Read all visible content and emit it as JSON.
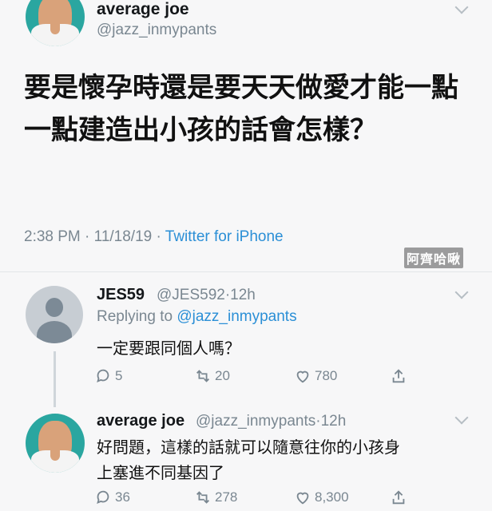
{
  "main_tweet": {
    "display_name": "average joe",
    "handle": "@jazz_inmypants",
    "text": "要是懷孕時還是要天天做愛才能一點一點建造出小孩的話會怎樣？",
    "time": "2:38 PM",
    "date": "11/18/19",
    "source": "Twitter for iPhone"
  },
  "watermark": "阿齊哈啾",
  "reply1": {
    "display_name": "JES59",
    "handle": "@JES592",
    "age": "12h",
    "replying_label": "Replying to",
    "replying_to": "@jazz_inmypants",
    "text": "一定要跟同個人嗎？",
    "replies": "5",
    "retweets": "20",
    "likes": "780"
  },
  "reply2": {
    "display_name": "average joe",
    "handle": "@jazz_inmypants",
    "age": "12h",
    "text_line1": "好問題，這樣的話就可以隨意往你的小孩身",
    "text_line2": "上塞進不同基因了",
    "replies": "36",
    "retweets": "278",
    "likes": "8,300"
  }
}
